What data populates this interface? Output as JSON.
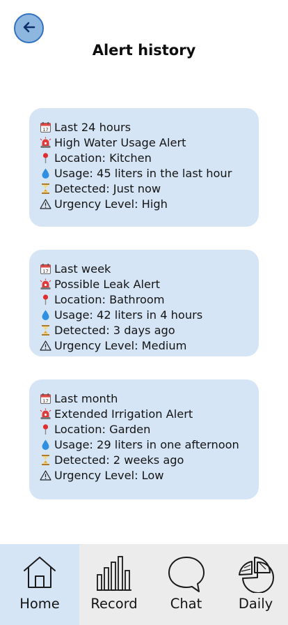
{
  "header": {
    "title": "Alert history",
    "back_icon": "arrow-left-icon"
  },
  "colors": {
    "card_bg": "#d5e5f6",
    "active_tab_bg": "#d5e5f6",
    "tabbar_bg": "#ececec",
    "back_button_fill": "#8eb7e0",
    "back_button_stroke": "#3372c2"
  },
  "alerts": [
    {
      "period": "Last 24 hours",
      "title": "High Water Usage Alert",
      "location": "Location: Kitchen",
      "usage": "Usage: 45 liters in the last hour",
      "detected": "Detected: Just now",
      "urgency": "Urgency Level: High"
    },
    {
      "period": "Last week",
      "title": "Possible Leak Alert",
      "location": "Location: Bathroom",
      "usage": "Usage: 42 liters in 4 hours",
      "detected": "Detected: 3 days ago",
      "urgency": "Urgency Level: Medium"
    },
    {
      "period": "Last month",
      "title": "Extended Irrigation Alert",
      "location": "Location: Garden",
      "usage": "Usage: 29 liters in one afternoon",
      "detected": "Detected: 2 weeks ago",
      "urgency": "Urgency Level: Low"
    }
  ],
  "line_icons": [
    "calendar-icon",
    "siren-icon",
    "pin-icon",
    "droplet-icon",
    "hourglass-icon",
    "warning-icon"
  ],
  "tabs": [
    {
      "label": "Home",
      "icon": "home-icon",
      "active": true
    },
    {
      "label": "Record",
      "icon": "bar-chart-icon",
      "active": false
    },
    {
      "label": "Chat",
      "icon": "chat-bubble-icon",
      "active": false
    },
    {
      "label": "Daily",
      "icon": "pie-chart-icon",
      "active": false
    }
  ]
}
